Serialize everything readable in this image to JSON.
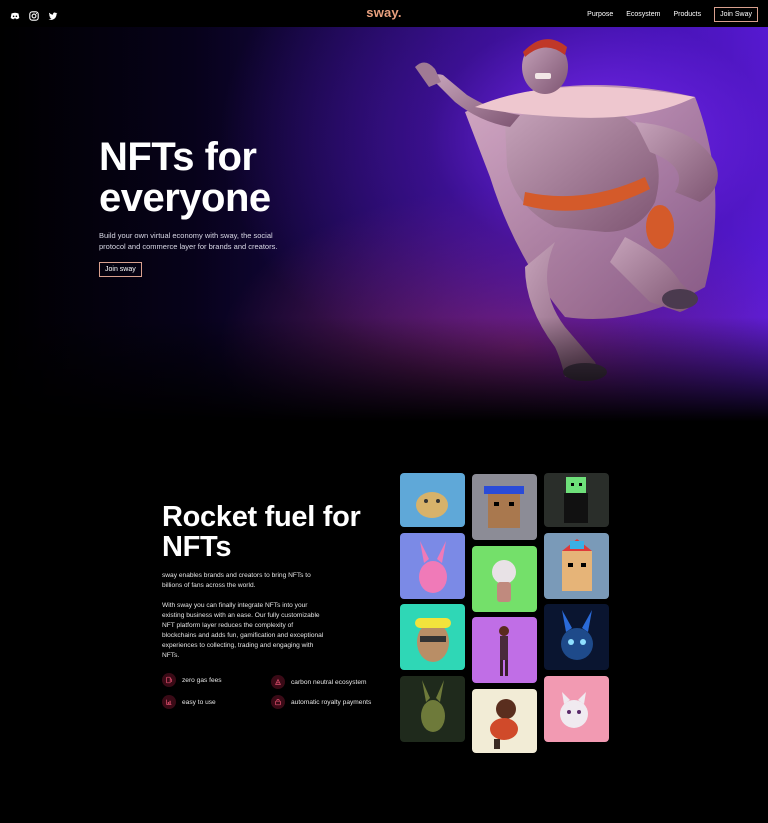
{
  "nav": {
    "brand": "sway.",
    "links": [
      "Purpose",
      "Ecosystem",
      "Products"
    ],
    "cta": "Join Sway",
    "social_icons": [
      "discord-icon",
      "instagram-icon",
      "twitter-icon"
    ]
  },
  "hero": {
    "title_line1": "NFTs for",
    "title_line2": "everyone",
    "subtitle": "Build your own virtual economy with sway, the social protocol and commerce layer for brands and creators.",
    "button": "Join sway"
  },
  "section": {
    "title_line1": "Rocket fuel for",
    "title_line2": "NFTs",
    "paragraph1": "sway enables brands and creators to bring NFTs to billions of fans across the world.",
    "paragraph2": "With sway you can finally integrate NFTs into your existing business with an ease. Our fully customizable NFT platform layer reduces the complexity of blockchains and adds fun, gamification and exceptional experiences to collecting, trading and engaging with NFTs.",
    "features": [
      {
        "label": "zero gas fees",
        "icon": "gas-icon"
      },
      {
        "label": "carbon neutral ecosystem",
        "icon": "globe-icon"
      },
      {
        "label": "easy to use",
        "icon": "chart-icon"
      },
      {
        "label": "automatic royalty payments",
        "icon": "royalty-icon"
      }
    ]
  },
  "colors": {
    "accent": "#e9a07e",
    "button_border": "#d9a08e",
    "hero_purple": "#5b1de6",
    "feature_icon_bg": "#3a0a16"
  }
}
